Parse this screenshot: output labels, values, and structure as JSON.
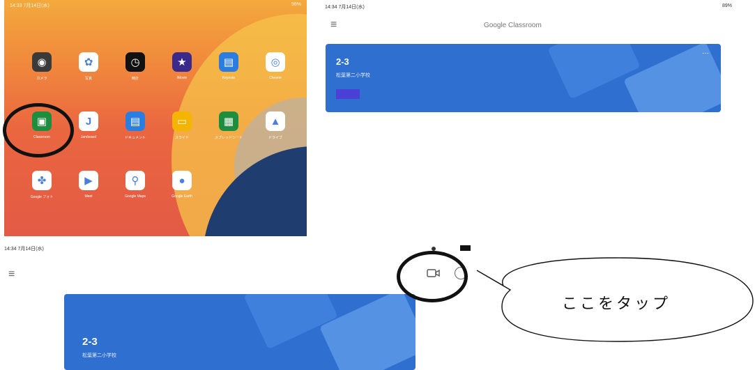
{
  "home_screen": {
    "status_left": "14:33 7月14日(水)",
    "status_right": "98%",
    "apps": [
      {
        "label": "カメラ",
        "icon": "camera-icon",
        "color": "#3a3a3a",
        "glyph": "◉"
      },
      {
        "label": "写真",
        "icon": "photos-icon",
        "color": "#ffffff",
        "glyph": "✿"
      },
      {
        "label": "時計",
        "icon": "clock-icon",
        "color": "#111111",
        "glyph": "◷"
      },
      {
        "label": "iMovie",
        "icon": "imovie-icon",
        "color": "#3b2a8c",
        "glyph": "★"
      },
      {
        "label": "Keynote",
        "icon": "keynote-icon",
        "color": "#2b7de0",
        "glyph": "▤"
      },
      {
        "label": "Chrome",
        "icon": "chrome-icon",
        "color": "#ffffff",
        "glyph": "◎"
      },
      {
        "label": "Classroom",
        "icon": "classroom-icon",
        "color": "#1e8e3e",
        "glyph": "▣"
      },
      {
        "label": "Jamboard",
        "icon": "jamboard-icon",
        "color": "#ffffff",
        "glyph": "J"
      },
      {
        "label": "ドキュメント",
        "icon": "docs-icon",
        "color": "#2b7de0",
        "glyph": "▤"
      },
      {
        "label": "スライド",
        "icon": "slides-icon",
        "color": "#f4b400",
        "glyph": "▭"
      },
      {
        "label": "スプレッドシート",
        "icon": "sheets-icon",
        "color": "#1e8e3e",
        "glyph": "▦"
      },
      {
        "label": "ドライブ",
        "icon": "drive-icon",
        "color": "#ffffff",
        "glyph": "▲"
      },
      {
        "label": "Google フォト",
        "icon": "google-photos-icon",
        "color": "#ffffff",
        "glyph": "✤"
      },
      {
        "label": "Meet",
        "icon": "meet-icon",
        "color": "#ffffff",
        "glyph": "▶"
      },
      {
        "label": "Google Maps",
        "icon": "maps-icon",
        "color": "#ffffff",
        "glyph": "⚲"
      },
      {
        "label": "Google Earth",
        "icon": "earth-icon",
        "color": "#ffffff",
        "glyph": "●"
      }
    ]
  },
  "classroom_top": {
    "status_left": "14:34 7月14日(水)",
    "status_right": "89%",
    "menu_icon": "≡",
    "title": "Google Classroom",
    "class_name": "2-3",
    "section": "松葉第二小学校",
    "more_icon": "···"
  },
  "classroom_bottom": {
    "status_left": "14:34 7月14日(水)",
    "menu_icon": "≡",
    "class_name": "2-3",
    "section": "松葉第二小学校"
  },
  "callout": {
    "text": "ここをタップ"
  },
  "colors": {
    "card_blue": "#2f6fcf",
    "marker": "#111111"
  }
}
